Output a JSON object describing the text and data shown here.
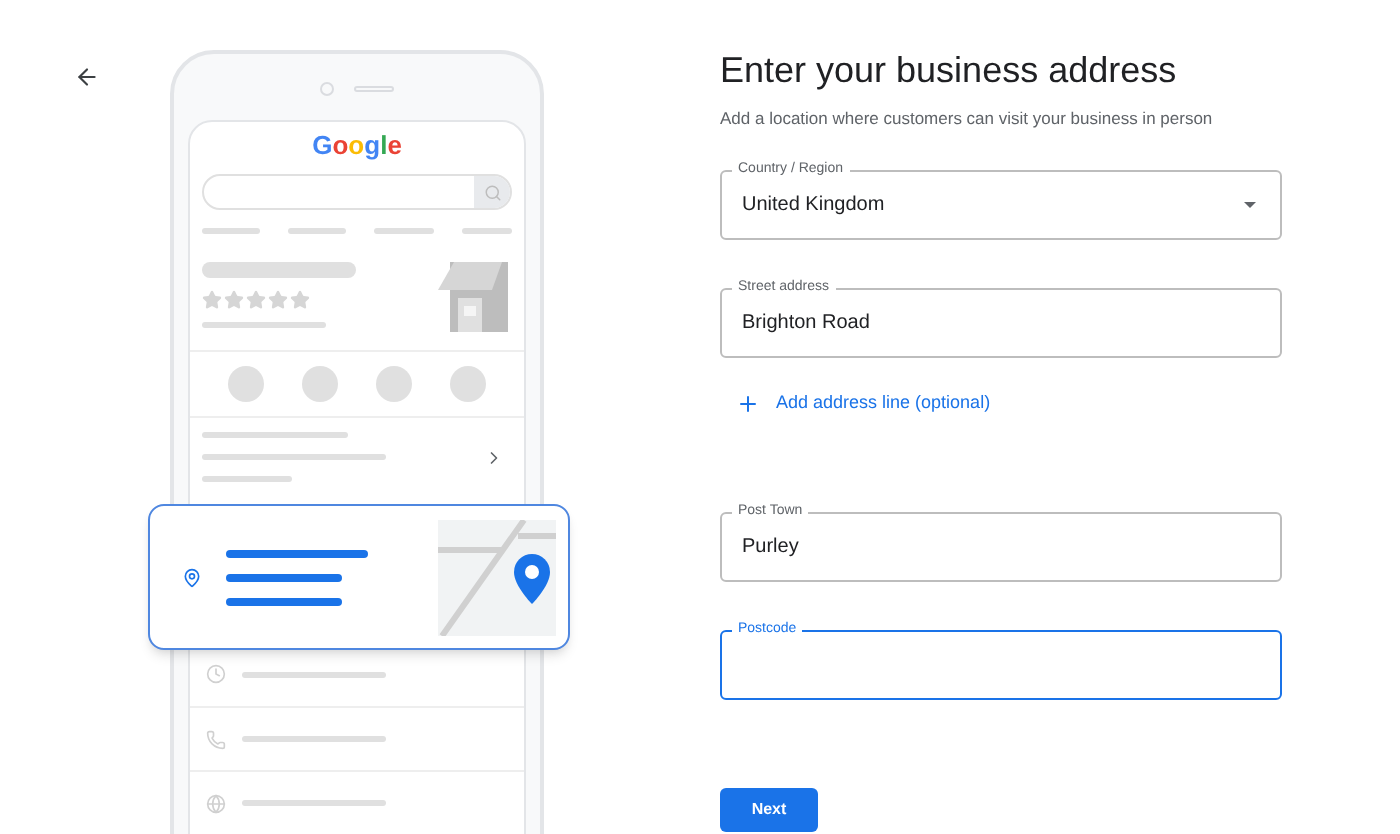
{
  "illustration": {
    "logo": "Google"
  },
  "form": {
    "title": "Enter your business address",
    "subtitle": "Add a location where customers can visit your business in person",
    "fields": [
      {
        "kind": "dropdown",
        "label": "Country / Region",
        "value": "United Kingdom",
        "focused": false
      },
      {
        "kind": "text",
        "label": "Street address",
        "value": "Brighton Road",
        "focused": false
      },
      {
        "kind": "link",
        "label": "Add address line (optional)"
      },
      {
        "kind": "text",
        "label": "Post Town",
        "value": "Purley",
        "focused": false
      },
      {
        "kind": "text",
        "label": "Postcode",
        "focused": true
      }
    ],
    "button": "Next"
  }
}
